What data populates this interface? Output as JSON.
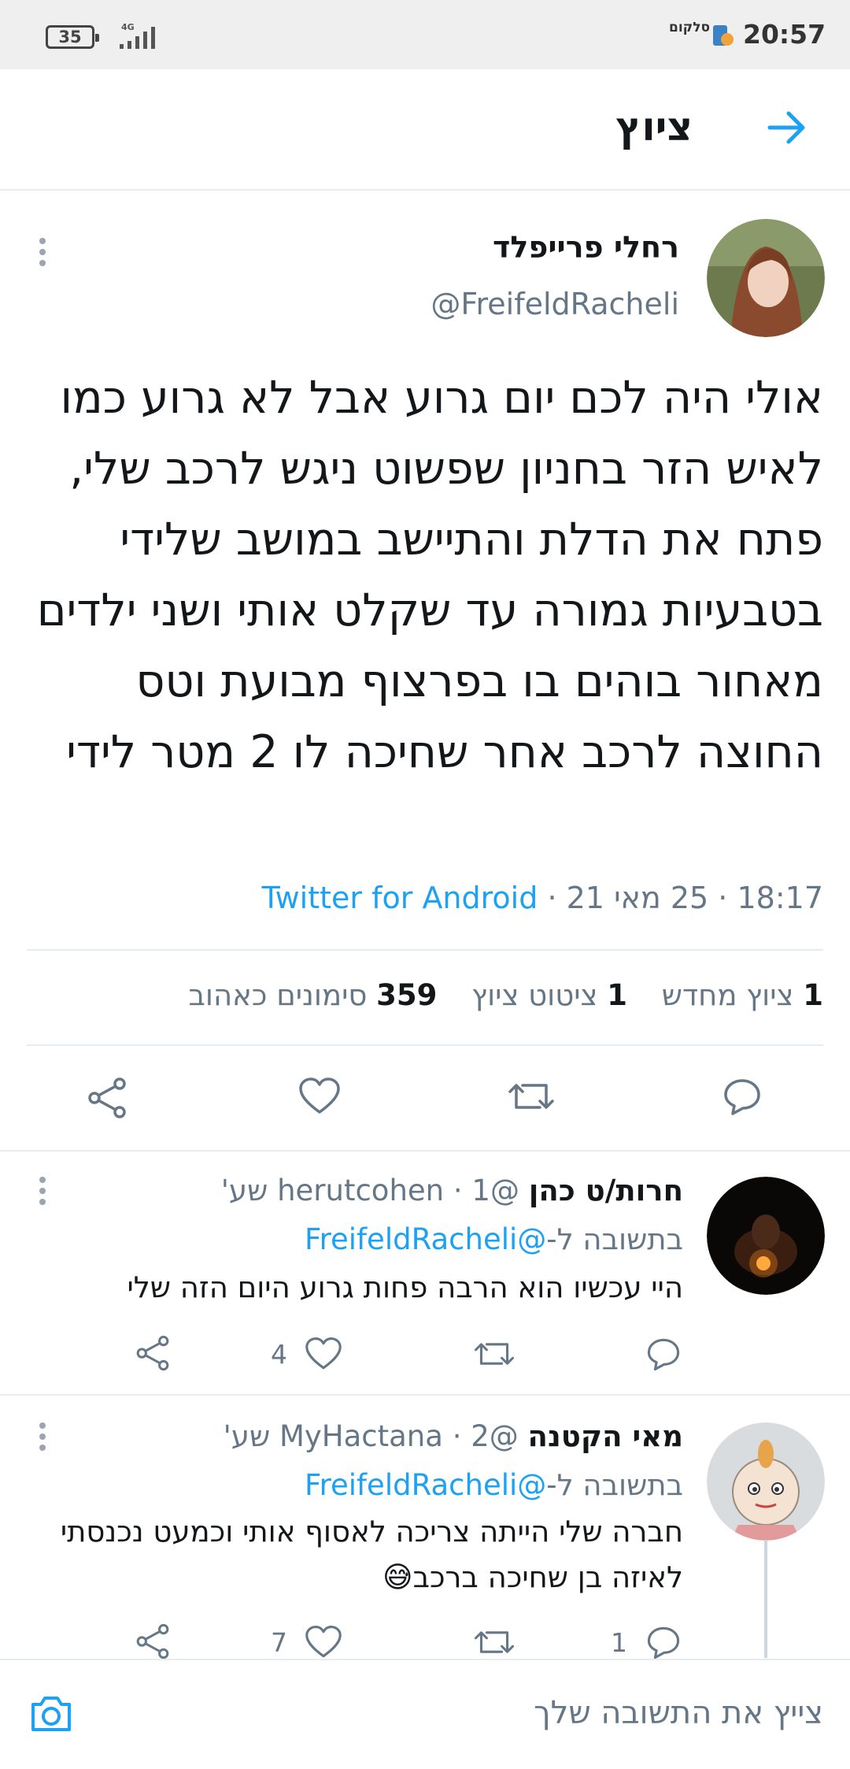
{
  "status_bar": {
    "battery": "35",
    "network": "4G",
    "carrier": "סלקום",
    "time": "20:57"
  },
  "header": {
    "title": "ציוץ",
    "back_icon": "arrow-icon"
  },
  "tweet": {
    "author_name": "רחלי פרייפלד",
    "author_handle": "@FreifeldRacheli",
    "text": "אולי היה לכם יום גרוע אבל לא גרוע כמו לאיש הזר בחניון שפשוט ניגש לרכב שלי, פתח את הדלת והתיישב במושב שלידי בטבעיות גמורה עד שקלט אותי ושני ילדים מאחור בוהים בו בפרצוף מבועת וטס החוצה לרכב אחר שחיכה לו 2 מטר לידי",
    "time": "18:17",
    "date": "25 מאי 21",
    "source": "Twitter for Android",
    "stats": {
      "retweets_count": "1",
      "retweets_label": "ציוץ מחדש",
      "quotes_count": "1",
      "quotes_label": "ציטוט ציוץ",
      "likes_count": "359",
      "likes_label": "סימונים כאהוב"
    }
  },
  "replies": [
    {
      "name": "חרות/ט כהן",
      "handle": "@herutcohen",
      "age": "1 שע'",
      "reply_to_label": "בתשובה ל-",
      "reply_to_handle": "@FreifeldRacheli",
      "text": "היי עכשיו הוא הרבה פחות גרוע היום הזה שלי",
      "reply_count": "",
      "retweet_count": "",
      "like_count": "4"
    },
    {
      "name": "מאי הקטנה",
      "handle": "@MyHactana",
      "age": "2 שע'",
      "reply_to_label": "בתשובה ל-",
      "reply_to_handle": "@FreifeldRacheli",
      "text": "חברה שלי הייתה צריכה לאסוף אותי וכמעט נכנסתי לאיזה בן שחיכה ברכב😅",
      "reply_count": "1",
      "retweet_count": "",
      "like_count": "7"
    }
  ],
  "compose": {
    "placeholder": "צייץ את התשובה שלך"
  },
  "colors": {
    "accent": "#1da1f2",
    "secondary_text": "#657786",
    "divider": "#e6ecf0"
  }
}
